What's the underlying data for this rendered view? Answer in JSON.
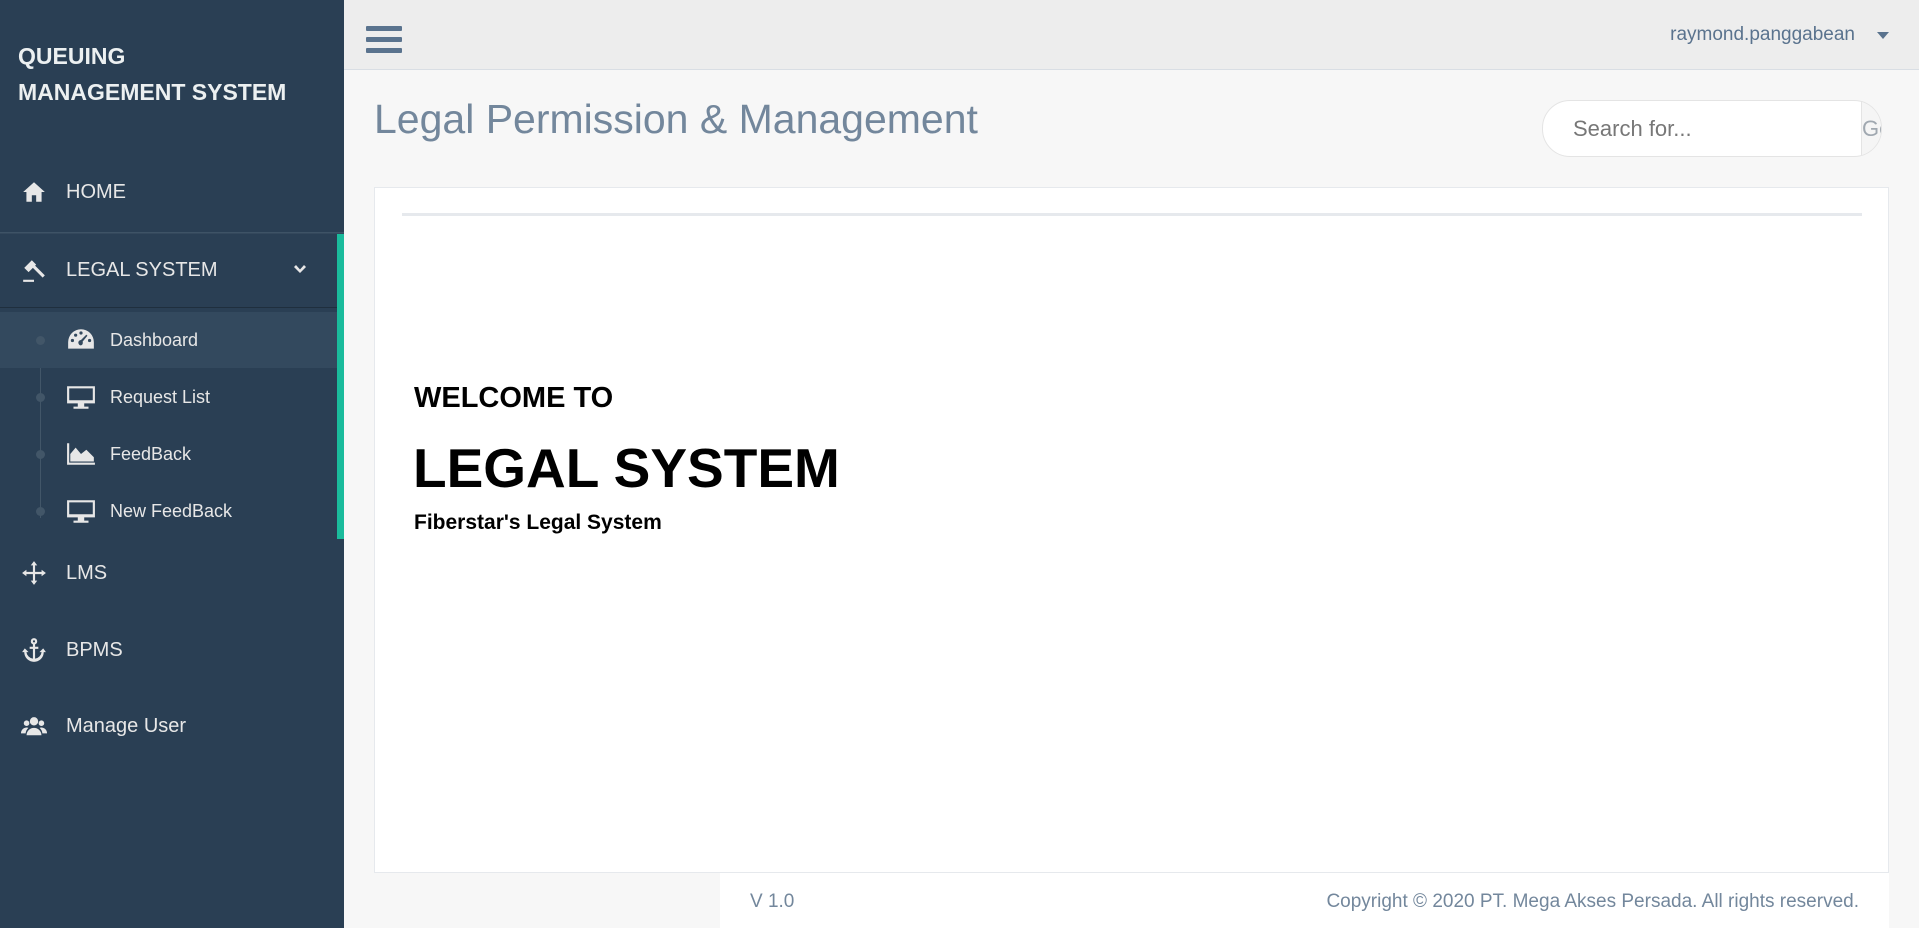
{
  "sidebar": {
    "brand_line1": "QUEUING",
    "brand_line2": "MANAGEMENT SYSTEM",
    "items": [
      {
        "label": "HOME",
        "icon": "home-icon"
      },
      {
        "label": "LEGAL SYSTEM",
        "icon": "gavel-icon"
      },
      {
        "label": "LMS",
        "icon": "arrows-icon"
      },
      {
        "label": "BPMS",
        "icon": "anchor-icon"
      },
      {
        "label": "Manage User",
        "icon": "users-icon"
      }
    ],
    "submenu": [
      {
        "label": "Dashboard",
        "icon": "dashboard-icon"
      },
      {
        "label": "Request List",
        "icon": "desktop-icon"
      },
      {
        "label": "FeedBack",
        "icon": "area-chart-icon"
      },
      {
        "label": "New FeedBack",
        "icon": "desktop-icon"
      }
    ]
  },
  "topnav": {
    "username": "raymond.panggabean"
  },
  "page": {
    "title": "Legal Permission & Management",
    "search_placeholder": "Search for...",
    "search_button": "Go!"
  },
  "welcome": {
    "line1": "WELCOME TO",
    "line2": "LEGAL SYSTEM",
    "line3": "Fiberstar's Legal System"
  },
  "footer": {
    "version": "V 1.0",
    "copyright": "Copyright © 2020 PT. Mega Akses Persada. All rights reserved."
  },
  "colors": {
    "sidebar_bg": "#2a3f54",
    "accent": "#1abb9c",
    "title_text": "#73879c"
  }
}
